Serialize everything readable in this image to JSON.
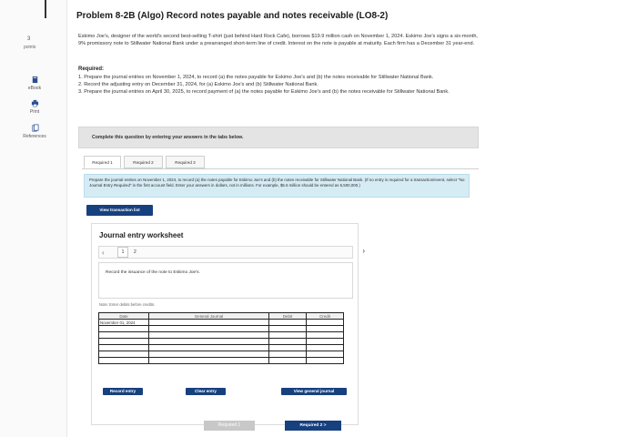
{
  "rail": {
    "question_number": "3",
    "points_label": "points",
    "items": [
      {
        "label": "eBook",
        "icon": "book-icon"
      },
      {
        "label": "Print",
        "icon": "print-icon"
      },
      {
        "label": "References",
        "icon": "references-icon"
      }
    ]
  },
  "problem": {
    "title": "Problem 8-2B (Algo) Record notes payable and notes receivable (LO8-2)",
    "description": "Eskimo Joe's, designer of the world's second best-selling T-shirt (just behind Hard Rock Cafe), borrows $19.9 million cash on November 1, 2024. Eskimo Joe's signs a six-month, 9% promissory note to Stillwater National Bank under a prearranged short-term line of credit. Interest on the note is payable at maturity. Each firm has a December 31 year-end.",
    "required_heading": "Required:",
    "required_items": [
      "1. Prepare the journal entries on November 1, 2024, to record (a) the notes payable for Eskimo Joe's and (b) the notes receivable for Stillwater National Bank.",
      "2. Record the adjusting entry on December 31, 2024, for (a) Eskimo Joe's and (b) Stillwater National Bank.",
      "3. Prepare the journal entries on April 30, 2025, to record payment of (a) the notes payable for Eskimo Joe's and (b) the notes receivable for Stillwater National Bank."
    ]
  },
  "instruction": "Complete this question by entering your answers in the tabs below.",
  "tabs": [
    "Required 1",
    "Required 2",
    "Required 3"
  ],
  "prompt": "Prepare the journal entries on November 1, 2024, to record (a) the notes payable for Eskimo Joe's and (b) the notes receivable for Stillwater National Bank. (If no entry is required for a transaction/event, select \"No Journal Entry Required\" in the first account field. Enter your answers in dollars, not in millions. For example, $5.5 million should be entered as 5,500,000.)",
  "view_transaction_list": "View transaction list",
  "worksheet": {
    "title": "Journal entry worksheet",
    "pages": [
      "1",
      "2"
    ],
    "record_text": "Record the issuance of the note to Eskimo Joe's.",
    "note": "Note: Enter debits before credits.",
    "columns": [
      "Date",
      "General Journal",
      "Debit",
      "Credit"
    ],
    "first_date": "November 01, 2024",
    "record_entry": "Record entry",
    "clear_entry": "Clear entry",
    "view_general_journal": "View general journal"
  },
  "footer": {
    "prev_label": "Required 1",
    "next_label": "Required 2  >"
  },
  "colors": {
    "primary_blue": "#17407e",
    "prompt_bg": "#d6ecf5"
  }
}
